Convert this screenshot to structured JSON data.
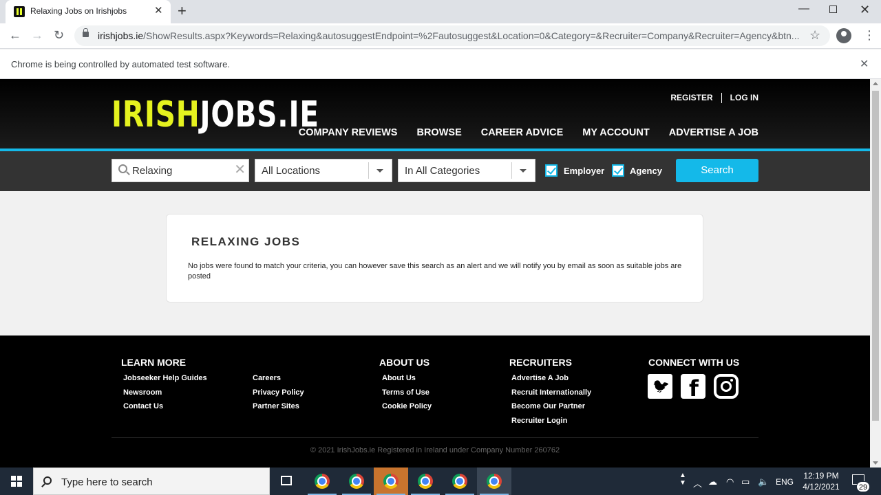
{
  "browser": {
    "tab_title": "Relaxing Jobs on Irishjobs",
    "tab_close": "✕",
    "new_tab": "+",
    "url_domain": "irishjobs.ie",
    "url_path": "/ShowResults.aspx?Keywords=Relaxing&autosuggestEndpoint=%2Fautosuggest&Location=0&Category=&Recruiter=Company&Recruiter=Agency&btn...",
    "infobar_text": "Chrome is being controlled by automated test software.",
    "back": "←",
    "forward": "→",
    "reload": "↻",
    "star": "☆",
    "menu": "⋮",
    "minimize": "—",
    "close": "✕"
  },
  "header": {
    "logo_irish": "IRISH",
    "logo_jobs": "JOBS.IE",
    "register": "REGISTER",
    "login": "LOG IN",
    "nav": [
      "COMPANY REVIEWS",
      "BROWSE",
      "CAREER ADVICE",
      "MY ACCOUNT",
      "ADVERTISE A JOB"
    ]
  },
  "search": {
    "keyword": "Relaxing",
    "clear": "✕",
    "location": "All Locations",
    "category": "In All Categories",
    "employer_label": "Employer",
    "employer_checked": true,
    "agency_label": "Agency",
    "agency_checked": true,
    "button": "Search"
  },
  "results": {
    "title": "RELAXING JOBS",
    "message": "No jobs were found to match your criteria, you can however save this search as an alert and we will notify you by email as soon as suitable jobs are posted"
  },
  "footer": {
    "learn_more": {
      "title": "LEARN MORE",
      "links": [
        "Jobseeker Help Guides",
        "Newsroom",
        "Contact Us",
        "Careers",
        "Privacy Policy",
        "Partner Sites"
      ]
    },
    "about_us": {
      "title": "ABOUT US",
      "links": [
        "About Us",
        "Terms of Use",
        "Cookie Policy"
      ]
    },
    "recruiters": {
      "title": "RECRUITERS",
      "links": [
        "Advertise A Job",
        "Recruit Internationally",
        "Become Our Partner",
        "Recruiter Login"
      ]
    },
    "connect": {
      "title": "CONNECT WITH US",
      "icons": [
        "twitter-icon",
        "facebook-icon",
        "instagram-icon"
      ]
    },
    "copyright": "© 2021 IrishJobs.ie Registered in Ireland under Company Number 260762"
  },
  "taskbar": {
    "search_placeholder": "Type here to search",
    "language": "ENG",
    "time": "12:19 PM",
    "date": "4/12/2021",
    "notifications": "29",
    "colors": {
      "taskbar": "#1f2a38",
      "accent": "#14b9e9",
      "logo_yellow": "#e5f21f"
    }
  }
}
